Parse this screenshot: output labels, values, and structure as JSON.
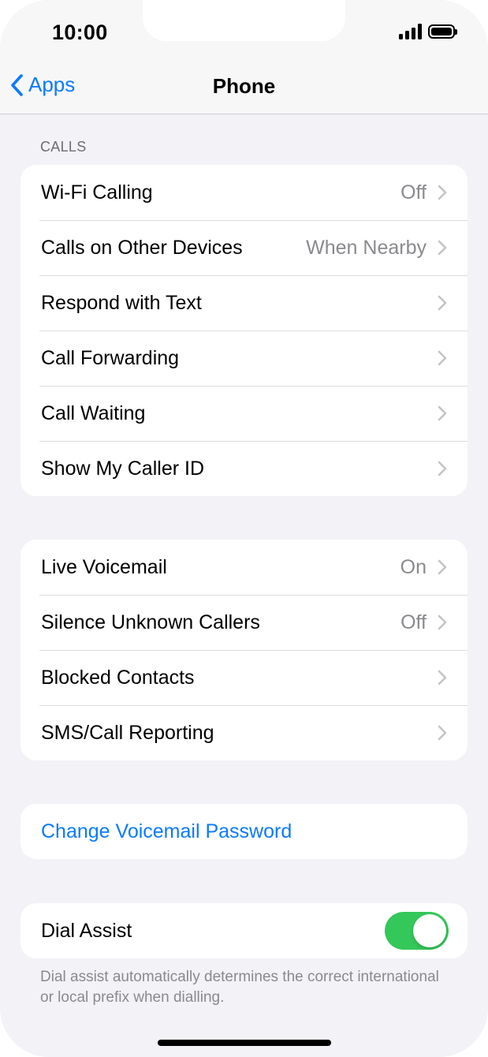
{
  "status_bar": {
    "time": "10:00",
    "signal_icon": "cellular-signal-icon",
    "battery_icon": "battery-icon"
  },
  "nav": {
    "back_label": "Apps",
    "back_icon": "chevron-left-icon",
    "title": "Phone"
  },
  "calls_section": {
    "header": "CALLS",
    "items": [
      {
        "label": "Wi-Fi Calling",
        "value": "Off"
      },
      {
        "label": "Calls on Other Devices",
        "value": "When Nearby"
      },
      {
        "label": "Respond with Text",
        "value": ""
      },
      {
        "label": "Call Forwarding",
        "value": ""
      },
      {
        "label": "Call Waiting",
        "value": ""
      },
      {
        "label": "Show My Caller ID",
        "value": ""
      }
    ]
  },
  "voicemail_section": {
    "items": [
      {
        "label": "Live Voicemail",
        "value": "On"
      },
      {
        "label": "Silence Unknown Callers",
        "value": "Off"
      },
      {
        "label": "Blocked Contacts",
        "value": ""
      },
      {
        "label": "SMS/Call Reporting",
        "value": ""
      }
    ]
  },
  "password_section": {
    "link_label": "Change Voicemail Password"
  },
  "dial_assist": {
    "label": "Dial Assist",
    "enabled": true,
    "footer": "Dial assist automatically determines the correct international or local prefix when dialling."
  },
  "colors": {
    "accent": "#0a7aff",
    "toggle_on": "#34c759",
    "background": "#f2f2f7",
    "secondary_text": "#8a8a8e"
  }
}
